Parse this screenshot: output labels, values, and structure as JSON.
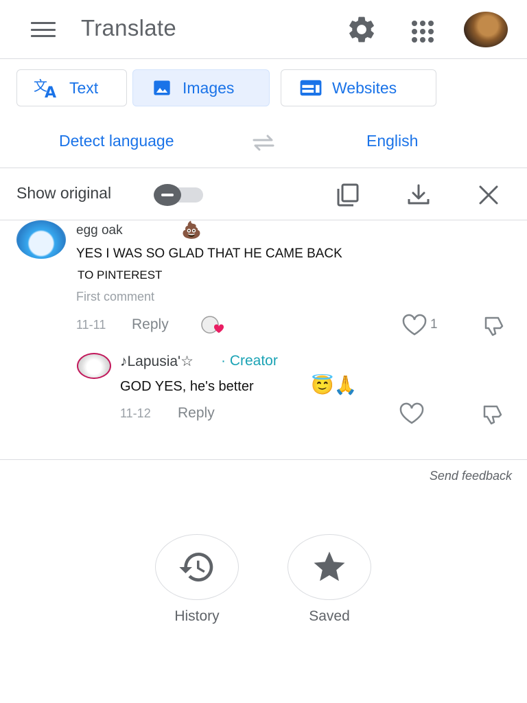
{
  "header": {
    "title": "Translate",
    "menu_icon": "hamburger-menu-icon",
    "settings_icon": "gear-icon",
    "apps_icon": "apps-grid-icon",
    "account_icon": "account-avatar"
  },
  "modes": [
    {
      "label": "Text",
      "icon": "translate-text-icon",
      "active": false
    },
    {
      "label": "Images",
      "icon": "image-icon",
      "active": true
    },
    {
      "label": "Websites",
      "icon": "website-icon",
      "active": false
    }
  ],
  "languages": {
    "source": "Detect language",
    "target": "English",
    "swap_icon": "swap-arrows-icon"
  },
  "toolbar": {
    "show_original_label": "Show original",
    "show_original_enabled": false,
    "copy_icon": "copy-icon",
    "download_icon": "download-icon",
    "close_icon": "close-icon"
  },
  "comments": [
    {
      "user": "egg oak",
      "badge_emoji": "💩",
      "text_line1": "YES I WAS SO GLAD THAT HE CAME BACK",
      "text_line2": "TO PINTEREST",
      "tag": "First comment",
      "date": "11-11",
      "reply_label": "Reply",
      "like_count": "1"
    },
    {
      "user": "♪Lapusia'☆",
      "role": "· Creator",
      "text": "GOD YES, he's better",
      "emoji": "😇🙏",
      "date": "11-12",
      "reply_label": "Reply"
    }
  ],
  "footer": {
    "send_feedback": "Send feedback",
    "history_label": "History",
    "saved_label": "Saved"
  },
  "colors": {
    "accent": "#1a73e8",
    "active_tab_bg": "#e8f0fe",
    "creator": "#1ba3b5",
    "icon_gray": "#5f6368",
    "divider": "#dadce0"
  }
}
